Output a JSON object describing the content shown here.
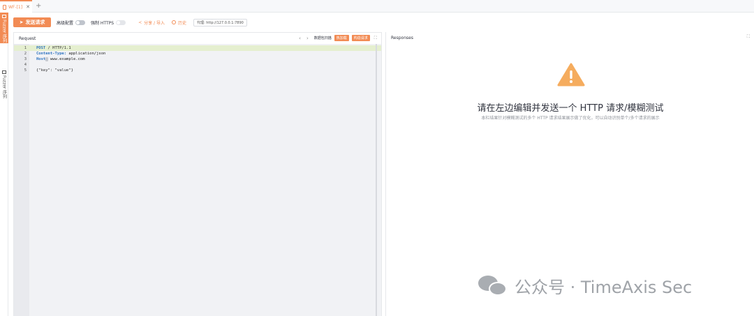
{
  "tab": {
    "title": "WF-[1]",
    "close": "✕",
    "add": "+"
  },
  "sidebar": {
    "active_tab": "Fuzzer 序列",
    "other_tab": "Fuzzer 序列"
  },
  "toolbar": {
    "send_label": "发送请求",
    "advanced_label": "高级配置",
    "force_https_label": "强制 HTTPS",
    "share_label": "分享 / 导入",
    "history_label": "历史",
    "proxy_label": "代理: http://127.0.0.1:7890"
  },
  "request": {
    "title": "Request",
    "data_extractor_label": "数据包扫描",
    "hot_patch_label": "热加载",
    "build_request_label": "构造请求",
    "lines": [
      {
        "num": "1",
        "method": "POST",
        "rest": " / HTTP/1.1"
      },
      {
        "num": "2",
        "key": "Content-Type:",
        "value": " application/json"
      },
      {
        "num": "3",
        "key": "Host",
        "value": " www.example.com"
      },
      {
        "num": "4",
        "text": ""
      },
      {
        "num": "5",
        "text": "{\"key\": \"value\"}"
      }
    ]
  },
  "responses": {
    "title": "Responses",
    "empty_title": "请在左边编辑并发送一个 HTTP 请求/模糊测试",
    "empty_subtitle": "本栏结果针对模糊测试的多个 HTTP 请求结果展示做了优化，可以自动识别单个/多个请求的展示"
  },
  "watermark": {
    "text": "公众号 · TimeAxis Sec"
  },
  "colors": {
    "accent": "#f28b54",
    "warning": "#f5ac5e",
    "highlight": "#e5efcf"
  }
}
